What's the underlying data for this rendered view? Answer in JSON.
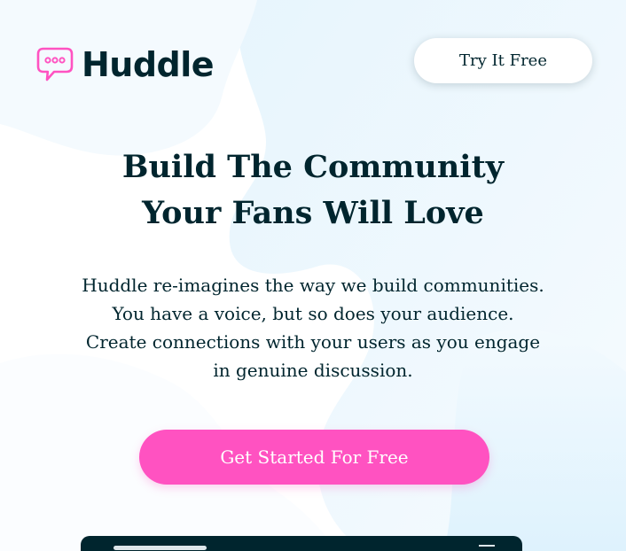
{
  "brand": {
    "name": "Huddle",
    "accent": "#ff52c1",
    "text_color": "#00252e"
  },
  "header": {
    "cta_label": "Try It Free"
  },
  "hero": {
    "title_line1": "Build The Community",
    "title_line2": "Your Fans Will Love",
    "description": "Huddle re-imagines the way we build communities. You have a voice, but so does your audience. Create connections with your users as you engage in genuine discussion.",
    "cta_label": "Get Started For Free"
  },
  "icons": {
    "logo": "chat-bubble-icon"
  }
}
